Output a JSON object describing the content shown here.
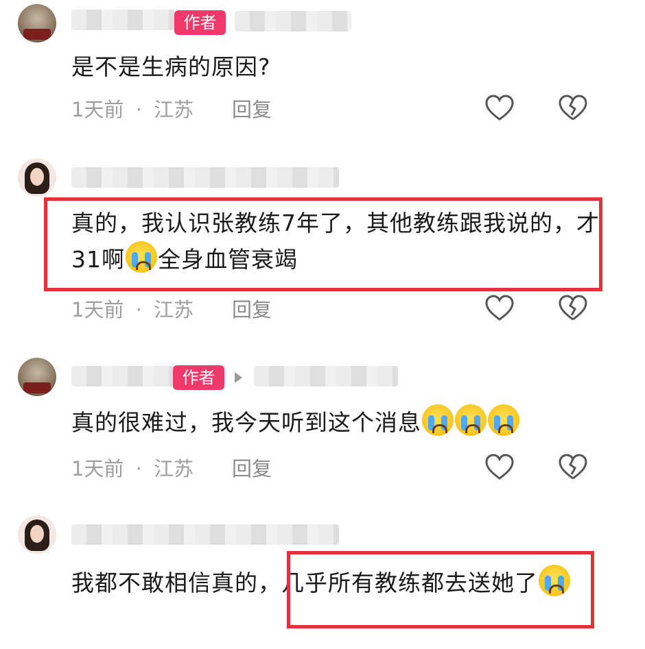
{
  "comments": [
    {
      "author_badge": "作者",
      "text": "是不是生病的原因?",
      "time": "1天前",
      "dot": "·",
      "location": "江苏",
      "reply": "回复"
    },
    {
      "text_before_emoji": "真的，我认识张教练7年了，其他教练跟我说的，才31啊",
      "emoji": "loudly-crying-emoji",
      "text_after_emoji": "全身血管衰竭",
      "time": "1天前",
      "dot": "·",
      "location": "江苏",
      "reply": "回复"
    },
    {
      "author_badge": "作者",
      "text": "真的很难过，我今天听到这个消息",
      "emoji_count": 3,
      "time": "1天前",
      "dot": "·",
      "location": "江苏",
      "reply": "回复"
    },
    {
      "text": "我都不敢相信真的，几乎所有教练都去送她了"
    }
  ],
  "icons": [
    "heart-icon",
    "broken-heart-icon"
  ],
  "colors": {
    "badge": "#f0396b",
    "highlight": "#e5313a",
    "meta": "#9e9e9e"
  }
}
